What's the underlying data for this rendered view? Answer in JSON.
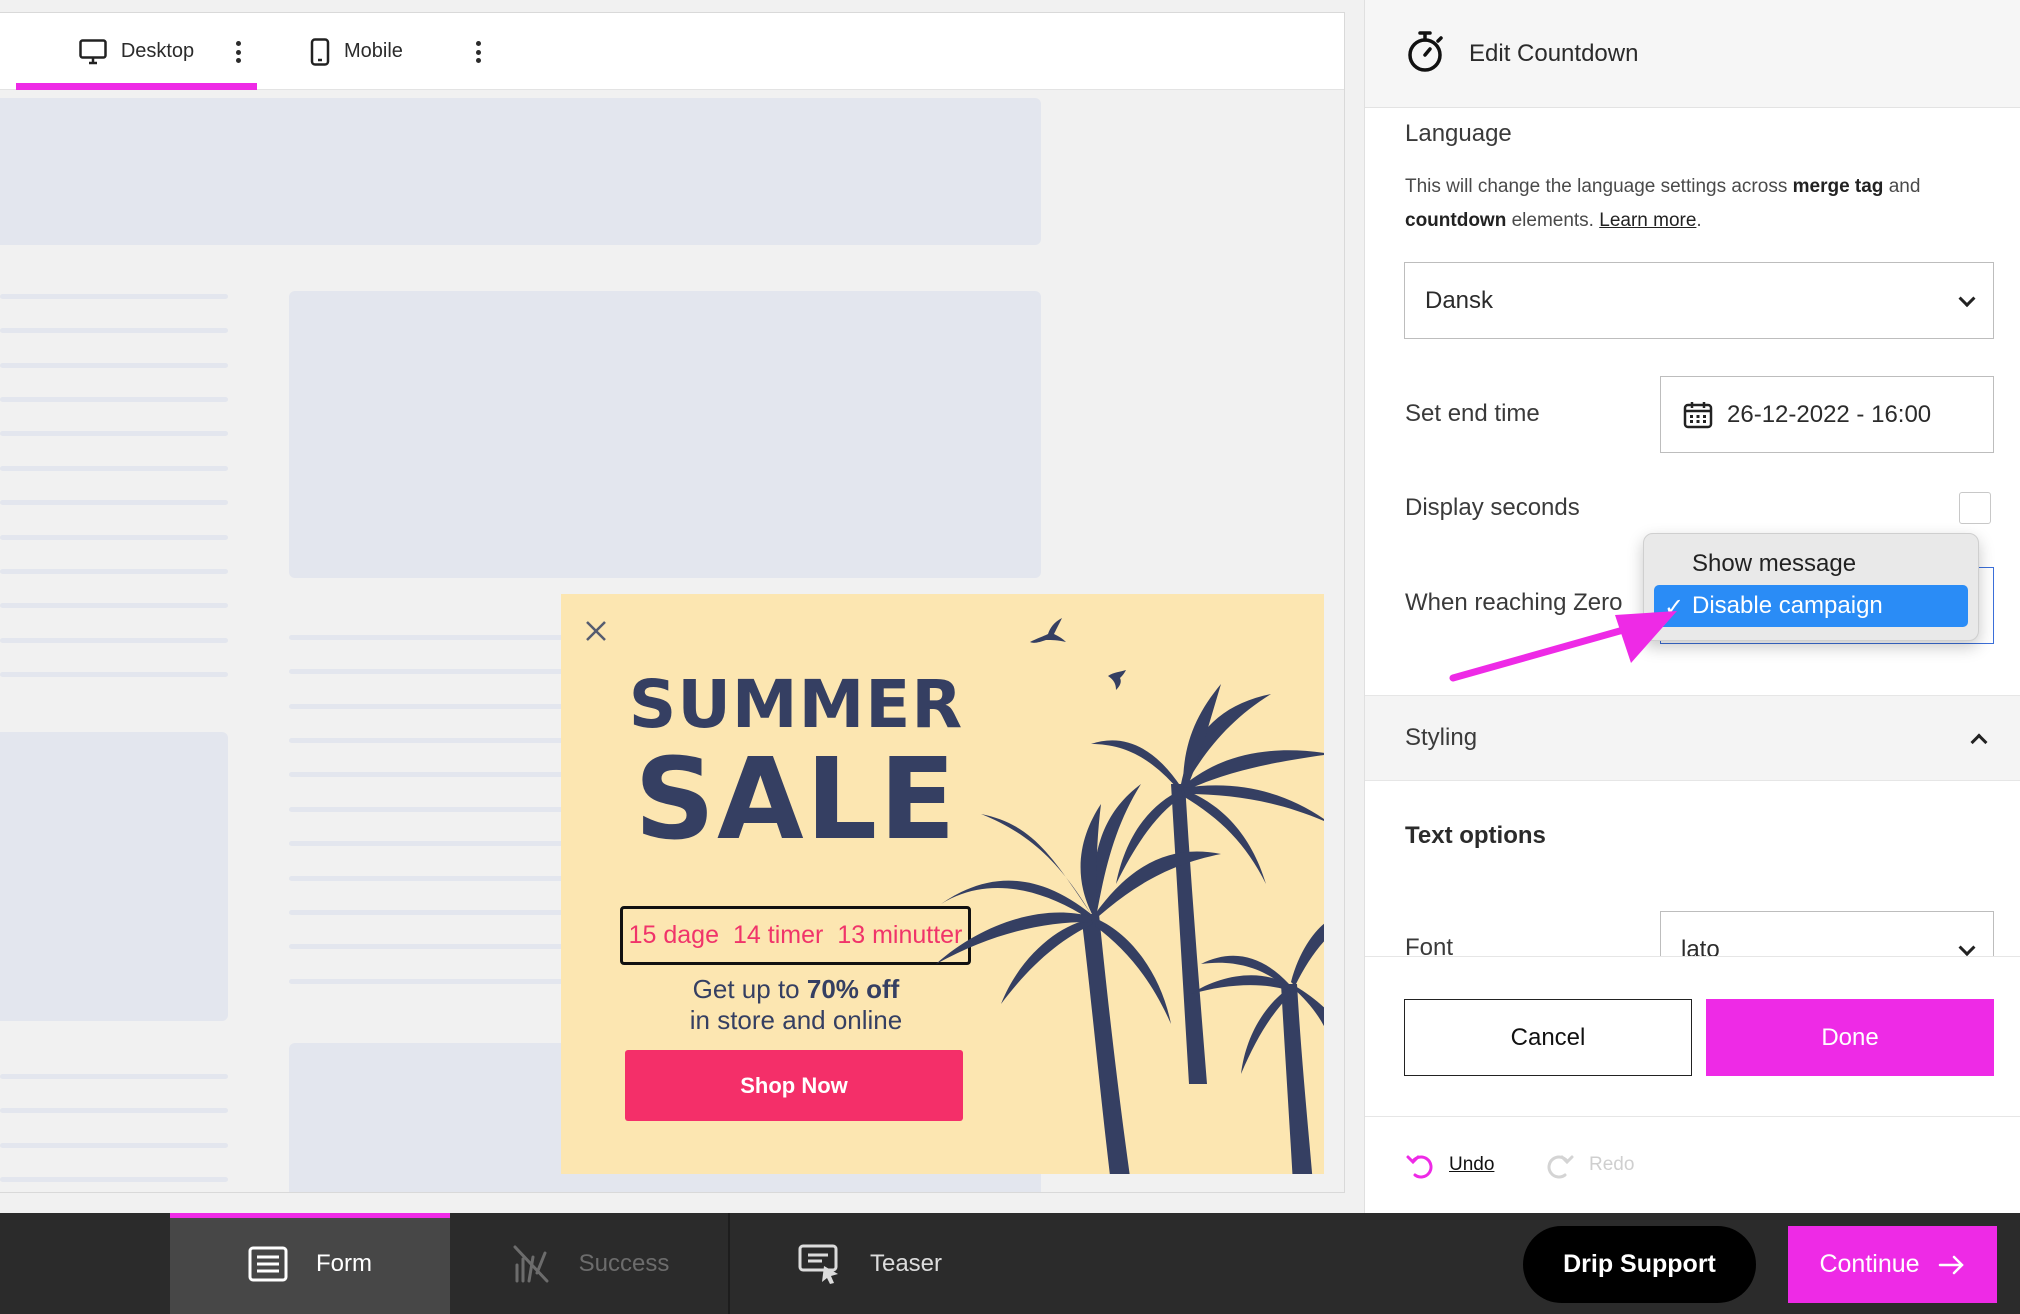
{
  "device_bar": {
    "desktop_label": "Desktop",
    "mobile_label": "Mobile"
  },
  "popup": {
    "headline_1": "SUMMER",
    "headline_2": "SALE",
    "countdown": {
      "days": "15 dage",
      "hours": "14 timer",
      "minutes": "13 minutter"
    },
    "sub_line_1_pre": "Get up to ",
    "sub_line_1_bold": "70% off",
    "sub_line_2": "in store and online",
    "button_label": "Shop Now"
  },
  "panel": {
    "title": "Edit Countdown",
    "language": {
      "label": "Language",
      "desc_1": "This will change the language settings across ",
      "desc_bold_1": "merge tag",
      "desc_2": " and ",
      "desc_bold_2": "countdown",
      "desc_3": " elements. ",
      "desc_link": "Learn more",
      "desc_4": ".",
      "selected": "Dansk"
    },
    "end_time": {
      "label": "Set end time",
      "value": "26-12-2022 - 16:00"
    },
    "display_seconds": {
      "label": "Display seconds",
      "checked": false
    },
    "when_zero": {
      "label": "When reaching Zero",
      "options": [
        "Show message",
        "Disable campaign"
      ],
      "selected": "Disable campaign"
    },
    "styling": {
      "label": "Styling",
      "text_options_label": "Text options",
      "font_label": "Font",
      "font_value": "lato"
    },
    "cancel_label": "Cancel",
    "done_label": "Done",
    "undo_label": "Undo",
    "redo_label": "Redo"
  },
  "bottom_bar": {
    "tabs": [
      {
        "label": "Form",
        "icon": "form-icon",
        "state": "active"
      },
      {
        "label": "Success",
        "icon": "success-icon",
        "state": "disabled"
      },
      {
        "label": "Teaser",
        "icon": "teaser-icon",
        "state": "normal"
      }
    ],
    "support_label": "Drip Support",
    "continue_label": "Continue"
  },
  "colors": {
    "accent": "#ee2ae6",
    "popup_bg": "#fce6b1",
    "popup_navy": "#353f62",
    "popup_red": "#f42f69",
    "select_blue": "#2a8cf6"
  }
}
